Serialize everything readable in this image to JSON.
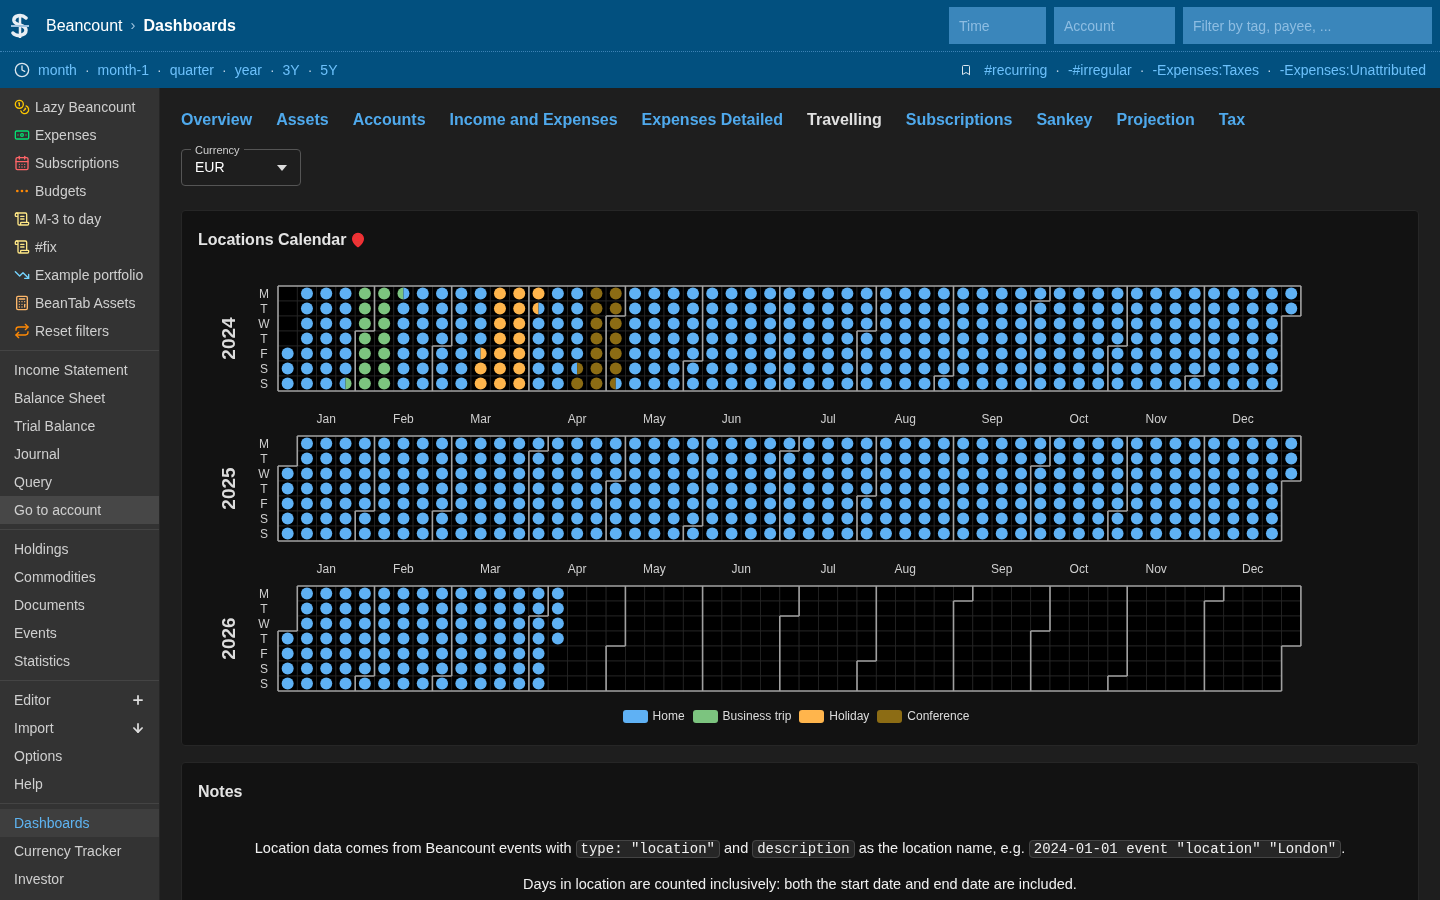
{
  "header": {
    "brand": "Beancount",
    "separator": "›",
    "page": "Dashboards",
    "filters": [
      {
        "placeholder": "Time"
      },
      {
        "placeholder": "Account"
      },
      {
        "placeholder": "Filter by tag, payee, ..."
      }
    ]
  },
  "time_links": [
    "month",
    "month-1",
    "quarter",
    "year",
    "3Y",
    "5Y"
  ],
  "link_separator": "·",
  "filter_links": [
    "#recurring",
    "-#irregular",
    "-Expenses:Taxes",
    "-Expenses:Unattributed"
  ],
  "sidebar": [
    {
      "kind": "links",
      "items": [
        {
          "label": "Lazy Beancount",
          "selected": false,
          "hovered": false
        },
        {
          "label": "Expenses",
          "selected": false,
          "hovered": false
        },
        {
          "label": "Subscriptions",
          "selected": false,
          "hovered": false
        },
        {
          "label": "Budgets",
          "selected": false,
          "hovered": false
        },
        {
          "label": "M-3 to day",
          "selected": false,
          "hovered": false
        },
        {
          "label": "#fix",
          "selected": false,
          "hovered": false
        },
        {
          "label": "Example portfolio",
          "selected": false,
          "hovered": false
        },
        {
          "label": "BeanTab Assets",
          "selected": false,
          "hovered": false
        },
        {
          "label": "Reset filters",
          "selected": false,
          "hovered": false
        }
      ]
    },
    {
      "kind": "plain",
      "items": [
        {
          "label": "Income Statement",
          "selected": false,
          "hovered": false
        },
        {
          "label": "Balance Sheet",
          "selected": false,
          "hovered": false
        },
        {
          "label": "Trial Balance",
          "selected": false,
          "hovered": false
        },
        {
          "label": "Journal",
          "selected": false,
          "hovered": false
        },
        {
          "label": "Query",
          "selected": false,
          "hovered": false
        },
        {
          "label": "Go to account",
          "selected": false,
          "hovered": true
        }
      ]
    },
    {
      "kind": "plain",
      "items": [
        {
          "label": "Holdings",
          "selected": false,
          "hovered": false
        },
        {
          "label": "Commodities",
          "selected": false,
          "hovered": false
        },
        {
          "label": "Documents",
          "selected": false,
          "hovered": false
        },
        {
          "label": "Events",
          "selected": false,
          "hovered": false
        },
        {
          "label": "Statistics",
          "selected": false,
          "hovered": false
        }
      ]
    },
    {
      "kind": "tools",
      "items": [
        {
          "label": "Editor",
          "selected": false,
          "hovered": false
        },
        {
          "label": "Import",
          "selected": false,
          "hovered": false
        },
        {
          "label": "Options",
          "selected": false,
          "hovered": false
        },
        {
          "label": "Help",
          "selected": false,
          "hovered": false
        }
      ]
    },
    {
      "kind": "plain",
      "items": [
        {
          "label": "Dashboards",
          "selected": true,
          "hovered": false
        },
        {
          "label": "Currency Tracker",
          "selected": false,
          "hovered": false
        },
        {
          "label": "Investor",
          "selected": false,
          "hovered": false
        }
      ]
    }
  ],
  "tabs": [
    {
      "label": "Overview",
      "selected": false
    },
    {
      "label": "Assets",
      "selected": false
    },
    {
      "label": "Accounts",
      "selected": false
    },
    {
      "label": "Income and Expenses",
      "selected": false
    },
    {
      "label": "Expenses Detailed",
      "selected": false
    },
    {
      "label": "Travelling",
      "selected": true
    },
    {
      "label": "Subscriptions",
      "selected": false
    },
    {
      "label": "Sankey",
      "selected": false
    },
    {
      "label": "Projection",
      "selected": false
    },
    {
      "label": "Tax",
      "selected": false
    }
  ],
  "currency": {
    "label": "Currency",
    "value": "EUR"
  },
  "locations_calendar": {
    "title": "Locations Calendar",
    "legend": [
      {
        "label": "Home",
        "color": "#5fb1f4"
      },
      {
        "label": "Business trip",
        "color": "#7cc47f"
      },
      {
        "label": "Holiday",
        "color": "#ffb54c"
      },
      {
        "label": "Conference",
        "color": "#8c6c14"
      }
    ],
    "years": [
      {
        "label": "2024",
        "weekdays": [
          "M",
          "T",
          "W",
          "T",
          "F",
          "S",
          "S"
        ],
        "months": [
          "Jan",
          "Feb",
          "Mar",
          "Apr",
          "May",
          "Jun",
          "Jul",
          "Aug",
          "Sep",
          "Oct",
          "Nov",
          "Dec"
        ],
        "kind": "picture"
      },
      {
        "label": "2025",
        "weekdays": [
          "M",
          "T",
          "W",
          "T",
          "F",
          "S",
          "S"
        ],
        "months": [
          "Jan",
          "Feb",
          "Mar",
          "Apr",
          "May",
          "Jun",
          "Jul",
          "Aug",
          "Sep",
          "Oct",
          "Nov",
          "Dec"
        ],
        "kind": "picture"
      },
      {
        "label": "2026",
        "weekdays": [
          "M",
          "T",
          "W",
          "T",
          "F",
          "S",
          "S"
        ],
        "kind": "picture"
      }
    ]
  },
  "notes": {
    "title": "Notes",
    "paragraphs": [
      [
        {
          "kind": "text",
          "text": "Location data comes from Beancount events with "
        },
        {
          "kind": "code",
          "text": "type: \"location\""
        },
        {
          "kind": "text",
          "text": " and "
        },
        {
          "kind": "code",
          "text": "description"
        },
        {
          "kind": "text",
          "text": " as the location name, e.g. "
        },
        {
          "kind": "code",
          "text": "2024-01-01 event \"location\" \"London\""
        },
        {
          "kind": "text",
          "text": "."
        }
      ],
      [
        {
          "kind": "text",
          "text": "Days in location are counted inclusively: both the start date and end date are included."
        }
      ]
    ]
  }
}
